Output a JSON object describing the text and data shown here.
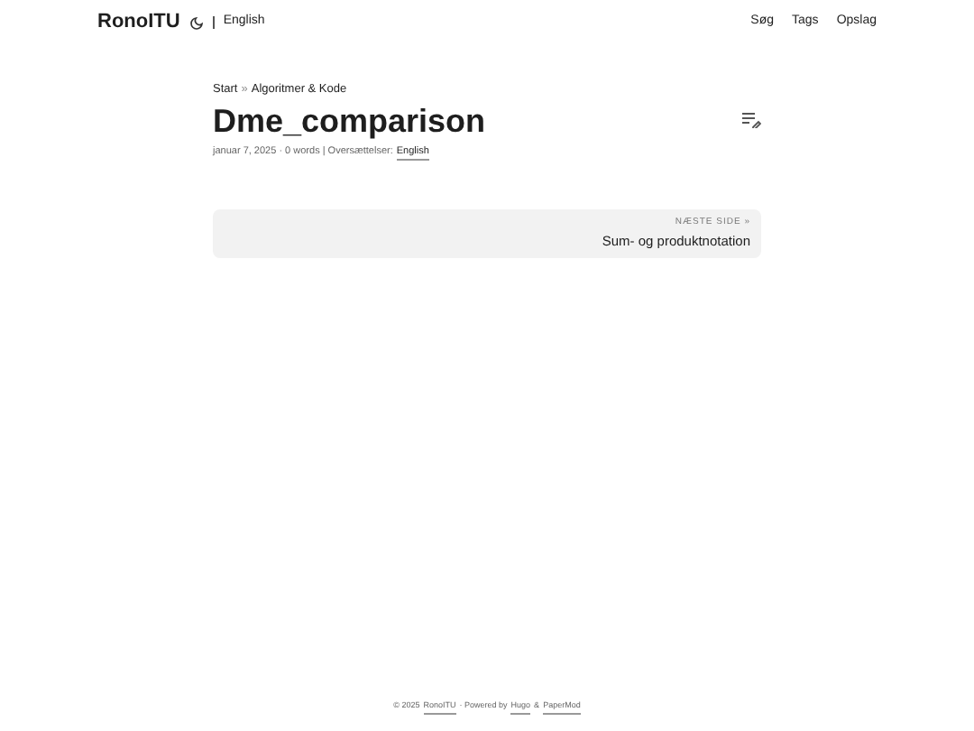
{
  "header": {
    "logo": "RonoITU",
    "language": "English",
    "menu": [
      "Søg",
      "Tags",
      "Opslag"
    ]
  },
  "breadcrumb": [
    "Start",
    "Algoritmer & Kode"
  ],
  "breadcrumb_separator": "»",
  "title": "Dme_comparison",
  "meta": {
    "text": "januar 7, 2025 · 0 words | Oversættelser:",
    "translation": "English"
  },
  "next_page": {
    "label": "NÆSTE SIDE »",
    "title": "Sum- og produktnotation"
  },
  "footer": {
    "copyright": "© 2025",
    "site": "RonoITU",
    "sep": "· Powered by",
    "hugo": "Hugo",
    "amp": "&",
    "theme": "PaperMod"
  }
}
